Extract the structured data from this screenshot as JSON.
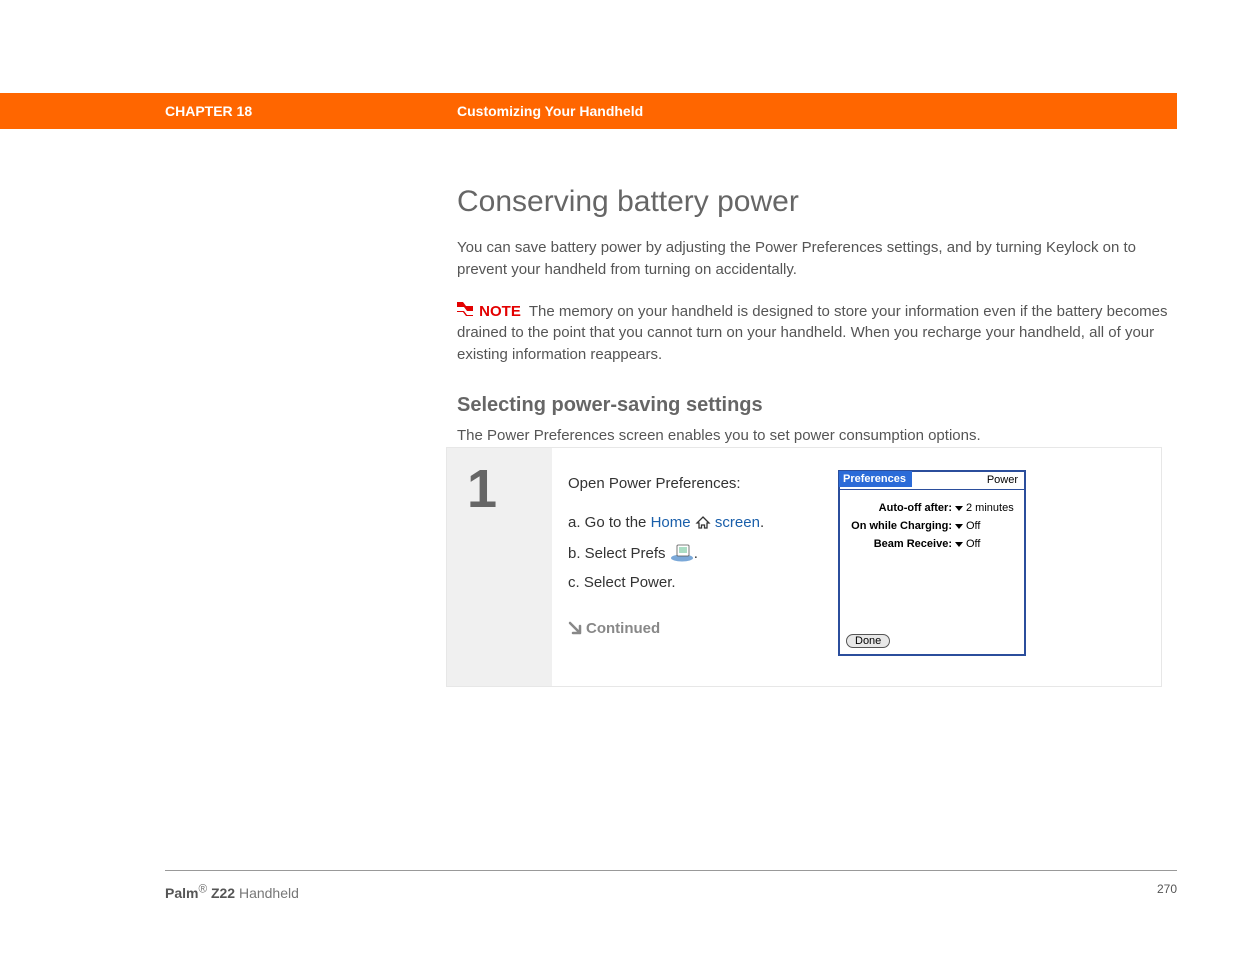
{
  "header": {
    "chapter": "CHAPTER 18",
    "title": "Customizing Your Handheld"
  },
  "page": {
    "h1": "Conserving battery power",
    "intro": "You can save battery power by adjusting the Power Preferences settings, and by turning Keylock on to prevent your handheld from turning on accidentally.",
    "note_label": "NOTE",
    "note_text": "The memory on your handheld is designed to store your information even if the battery becomes drained to the point that you cannot turn on your handheld. When you recharge your handheld, all of your existing information reappears.",
    "h2": "Selecting power-saving settings",
    "subintro": "The Power Preferences screen enables you to set power consumption options."
  },
  "step": {
    "number": "1",
    "lead": "Open Power Preferences:",
    "a_prefix": "a.  Go to the ",
    "a_link": "Home",
    "a_suffix": " screen",
    "a_period": ".",
    "b_prefix": "b.  Select Prefs ",
    "b_period": ".",
    "c": "c.   Select Power.",
    "continued": "Continued"
  },
  "palm": {
    "tab": "Preferences",
    "category": "Power",
    "rows": [
      {
        "label": "Auto-off after:",
        "value": "2 minutes"
      },
      {
        "label": "On while Charging:",
        "value": "Off"
      },
      {
        "label": "Beam Receive:",
        "value": "Off"
      }
    ],
    "done": "Done"
  },
  "footer": {
    "brand_bold": "Palm",
    "brand_reg": "®",
    "model_bold": " Z22",
    "suffix": " Handheld",
    "page_number": "270"
  }
}
